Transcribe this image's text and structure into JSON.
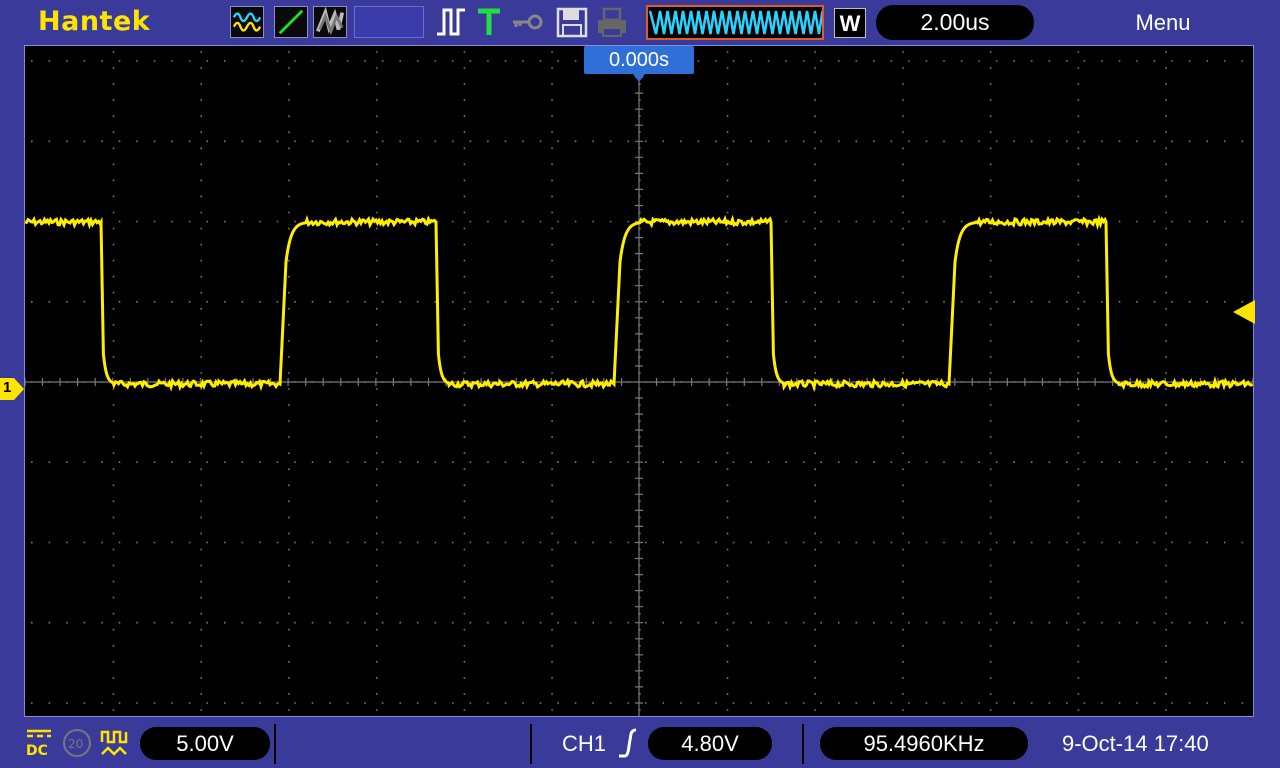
{
  "header": {
    "brand": "Hantek",
    "icons": [
      "fft-math-icon",
      "ref-line-icon",
      "persistence-icon",
      "run-stop-icon",
      "trigger-t-icon",
      "key-lock-icon",
      "save-disk-icon",
      "printer-icon"
    ],
    "waveform_preview_icon": "memory-waveform-preview",
    "window_mode": "W",
    "timebase": "2.00us",
    "menu_label": "Menu"
  },
  "screen": {
    "trigger_position": "0.000s",
    "channel_marker": "1",
    "trace_color": "#ffee00",
    "grid_color": "#7a7a7a"
  },
  "footer": {
    "coupling": "DC",
    "coupling_icons": [
      "dc-coupling-icon",
      "bandwidth-limit-20m-icon",
      "probe-icon"
    ],
    "volts_per_div": "5.00V",
    "trigger_channel": "CH1",
    "trigger_slope_icon": "rising-edge-icon",
    "trigger_level": "4.80V",
    "frequency": "95.4960KHz",
    "datetime": "9-Oct-14 17:40"
  }
}
